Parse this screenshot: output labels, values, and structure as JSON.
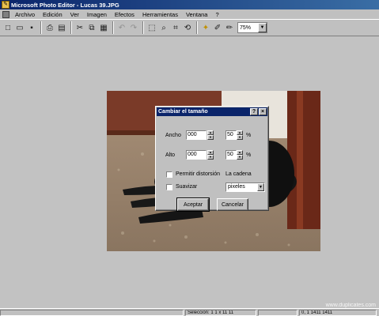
{
  "window": {
    "title": "Microsoft Photo Editor - Lucas 39.JPG"
  },
  "menu": [
    "Archivo",
    "Edición",
    "Ver",
    "Imagen",
    "Efectos",
    "Herramientas",
    "Ventana",
    "?"
  ],
  "toolbar": {
    "zoom_value": "75%"
  },
  "dialog": {
    "title": "Cambiar el tamaño",
    "help_label": "?",
    "close_label": "×",
    "width_label": "Ancho",
    "width_value": "000",
    "width_pct": "50",
    "height_label": "Alto",
    "height_value": "000",
    "height_pct": "50",
    "pct_symbol": "%",
    "keep_ratio_label": "Permitir distorsión",
    "unit_label": "La cadena",
    "smooth_label": "Suavizar",
    "unit_select": "pixeles",
    "ok_label": "Aceptar",
    "cancel_label": "Cancelar"
  },
  "status": {
    "selection": "Selección: 1 1 x 11 11",
    "coords": "0, 1  1411 1411"
  },
  "watermark": "www.duplicates.com"
}
